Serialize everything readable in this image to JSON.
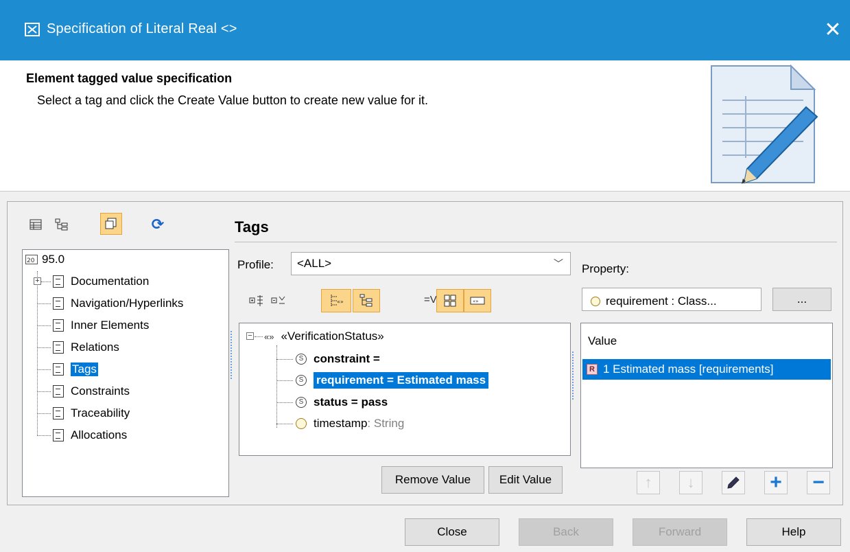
{
  "window": {
    "title": "Specification of Literal Real <>",
    "close_glyph": "✕"
  },
  "header": {
    "title": "Element tagged value specification",
    "subtitle": "Select a tag and click the Create Value button to create new value for it."
  },
  "toolbar_left": [
    "table-view-icon",
    "tree-view-icon",
    "compartments-icon",
    "refresh-icon"
  ],
  "tree": {
    "root": "95.0",
    "items": [
      {
        "label": "Documentation"
      },
      {
        "label": "Navigation/Hyperlinks"
      },
      {
        "label": "Inner Elements"
      },
      {
        "label": "Relations"
      },
      {
        "label": "Tags"
      },
      {
        "label": "Constraints"
      },
      {
        "label": "Traceability"
      },
      {
        "label": "Allocations"
      }
    ]
  },
  "tags_panel": {
    "title": "Tags",
    "profile_label": "Profile:",
    "profile_value": "<ALL>",
    "stereotype": "«VerificationStatus»",
    "stereotype_glyph": "«»",
    "rows": [
      {
        "name": "constraint =",
        "bold": true,
        "icon": "S"
      },
      {
        "name": "requirement = Estimated mass",
        "bold": true,
        "icon": "S"
      },
      {
        "name": "status = pass",
        "bold": true,
        "icon": "S"
      },
      {
        "name": "timestamp",
        "type": " : String",
        "bold": false,
        "icon": "○"
      }
    ],
    "remove_value": "Remove Value",
    "edit_value": "Edit Value",
    "equals_label": "=V"
  },
  "property_panel": {
    "label": "Property:",
    "field_value": "requirement : Class...",
    "more_button": "...",
    "value_header": "Value",
    "value_row": "1 Estimated mass [requirements]",
    "value_badge": "R"
  },
  "footer": {
    "close": "Close",
    "back": "Back",
    "forward": "Forward",
    "help": "Help"
  },
  "colors": {
    "title_bar": "#1e8cd0",
    "selection": "#0078d7",
    "toggle_on": "#fbd58a"
  }
}
